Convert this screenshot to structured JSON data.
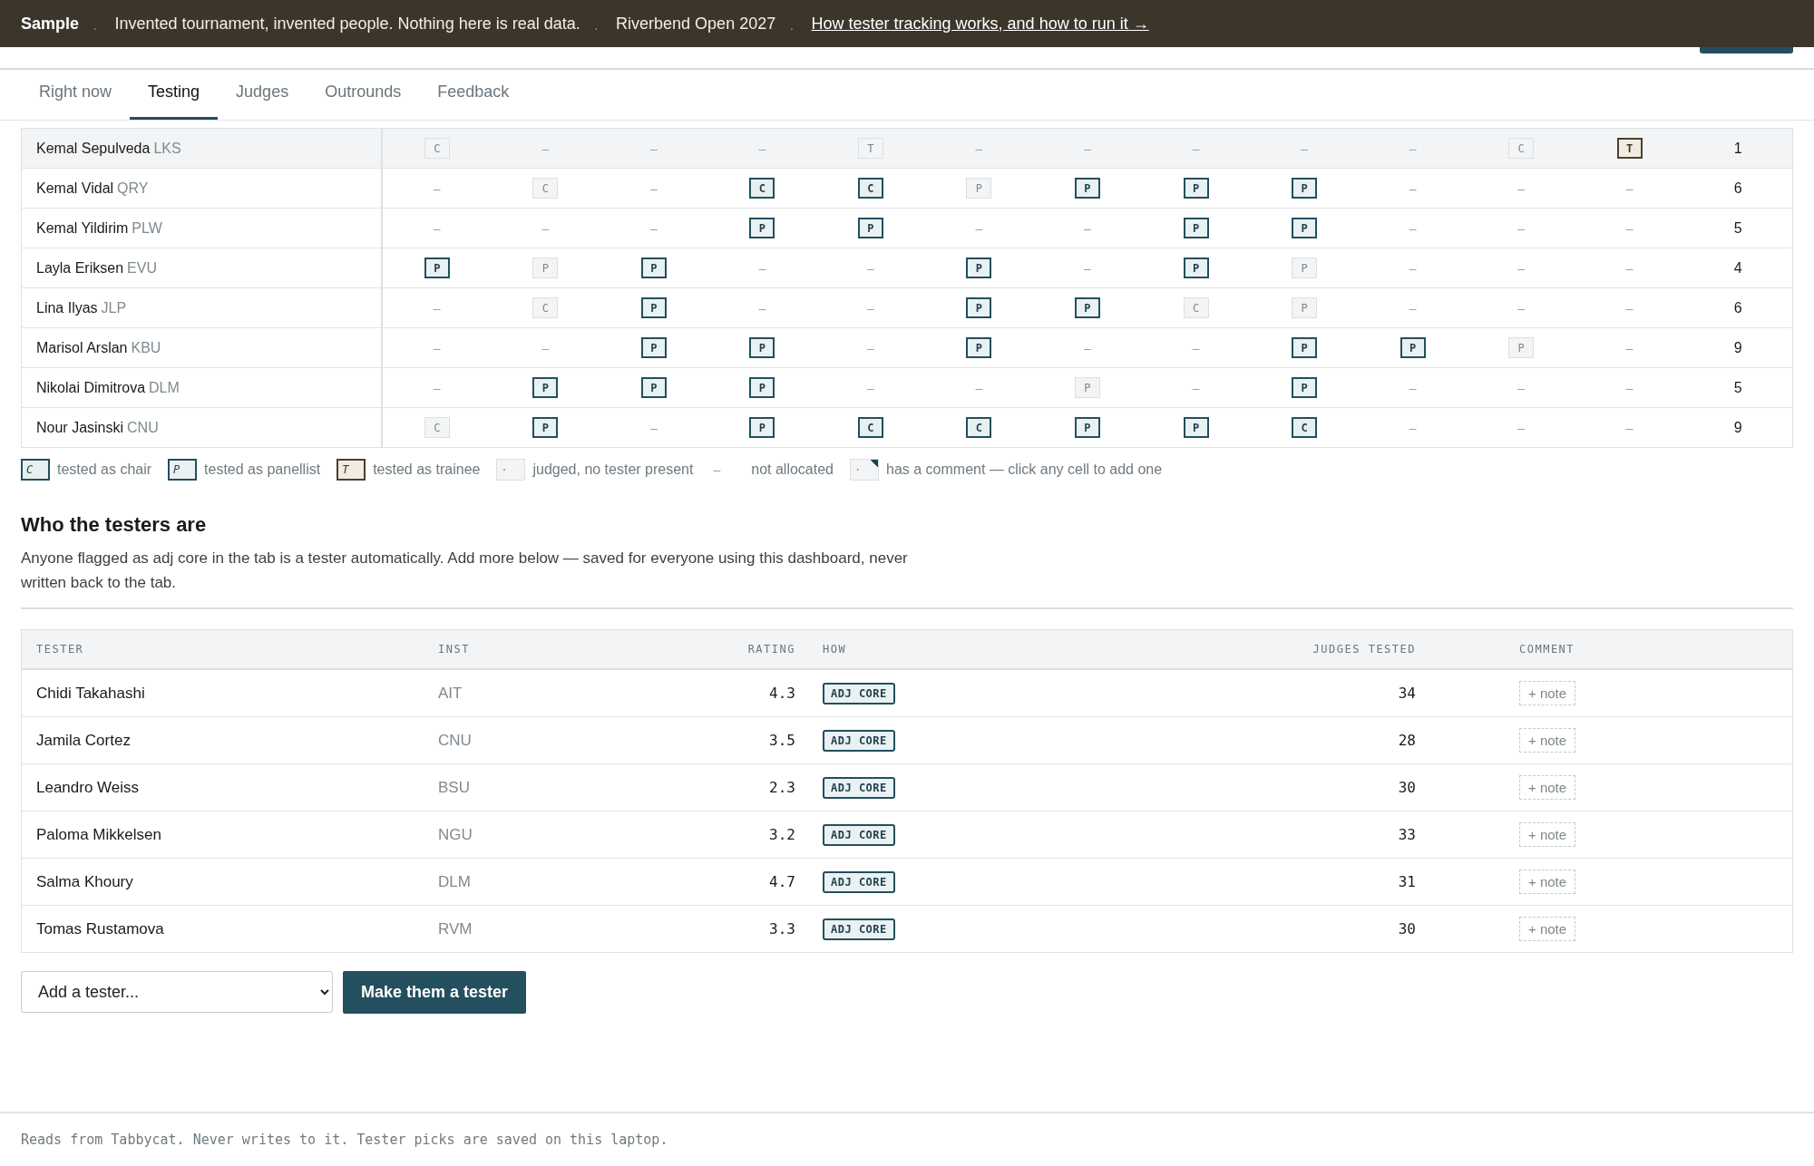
{
  "top_bar": {
    "items": [
      {
        "kind": "brand",
        "text": "Sample"
      },
      {
        "kind": "sep",
        "text": "."
      },
      {
        "kind": "text",
        "text": "Invented tournament, invented people. Nothing here is real data."
      },
      {
        "kind": "sep",
        "text": "."
      },
      {
        "kind": "text",
        "text": "Riverbend Open 2027"
      },
      {
        "kind": "sep",
        "text": "."
      },
      {
        "kind": "link",
        "text": "How tester tracking works, and how to run it →"
      }
    ]
  },
  "tabs": [
    {
      "label": "Right now",
      "selected": false
    },
    {
      "label": "Testing",
      "selected": true
    },
    {
      "label": "Judges",
      "selected": false
    },
    {
      "label": "Outrounds",
      "selected": false
    },
    {
      "label": "Feedback",
      "selected": false
    }
  ],
  "grid": {
    "rows": [
      {
        "name": "Kemal Sepulveda",
        "inst": "LKS",
        "highlighted": true,
        "count": "1",
        "cells": [
          {
            "kind": "untested",
            "text": "C"
          },
          {
            "kind": "empty",
            "text": "–"
          },
          {
            "kind": "empty",
            "text": "–"
          },
          {
            "kind": "empty",
            "text": "–"
          },
          {
            "kind": "untested",
            "text": "T"
          },
          {
            "kind": "empty",
            "text": "–"
          },
          {
            "kind": "empty",
            "text": "–"
          },
          {
            "kind": "empty",
            "text": "–"
          },
          {
            "kind": "empty",
            "text": "–"
          },
          {
            "kind": "empty",
            "text": "–"
          },
          {
            "kind": "untested",
            "text": "C"
          },
          {
            "kind": "trainee",
            "text": "T"
          }
        ]
      },
      {
        "name": "Kemal Vidal",
        "inst": "QRY",
        "highlighted": false,
        "count": "6",
        "cells": [
          {
            "kind": "empty",
            "text": "–"
          },
          {
            "kind": "untested",
            "text": "C"
          },
          {
            "kind": "empty",
            "text": "–"
          },
          {
            "kind": "chair",
            "text": "C"
          },
          {
            "kind": "chair",
            "text": "C"
          },
          {
            "kind": "untested",
            "text": "P"
          },
          {
            "kind": "panellist",
            "text": "P"
          },
          {
            "kind": "panellist",
            "text": "P"
          },
          {
            "kind": "panellist",
            "text": "P"
          },
          {
            "kind": "empty",
            "text": "–"
          },
          {
            "kind": "empty",
            "text": "–"
          },
          {
            "kind": "empty",
            "text": "–"
          }
        ]
      },
      {
        "name": "Kemal Yildirim",
        "inst": "PLW",
        "highlighted": false,
        "count": "5",
        "cells": [
          {
            "kind": "empty",
            "text": "–"
          },
          {
            "kind": "empty",
            "text": "–"
          },
          {
            "kind": "empty",
            "text": "–"
          },
          {
            "kind": "panellist",
            "text": "P"
          },
          {
            "kind": "panellist",
            "text": "P"
          },
          {
            "kind": "empty",
            "text": "–"
          },
          {
            "kind": "empty",
            "text": "–"
          },
          {
            "kind": "panellist",
            "text": "P"
          },
          {
            "kind": "panellist",
            "text": "P"
          },
          {
            "kind": "empty",
            "text": "–"
          },
          {
            "kind": "empty",
            "text": "–"
          },
          {
            "kind": "empty",
            "text": "–"
          }
        ]
      },
      {
        "name": "Layla Eriksen",
        "inst": "EVU",
        "highlighted": false,
        "count": "4",
        "cells": [
          {
            "kind": "panellist",
            "text": "P"
          },
          {
            "kind": "untested",
            "text": "P"
          },
          {
            "kind": "panellist",
            "text": "P"
          },
          {
            "kind": "empty",
            "text": "–"
          },
          {
            "kind": "empty",
            "text": "–"
          },
          {
            "kind": "panellist",
            "text": "P"
          },
          {
            "kind": "empty",
            "text": "–"
          },
          {
            "kind": "panellist",
            "text": "P"
          },
          {
            "kind": "untested",
            "text": "P"
          },
          {
            "kind": "empty",
            "text": "–"
          },
          {
            "kind": "empty",
            "text": "–"
          },
          {
            "kind": "empty",
            "text": "–"
          }
        ]
      },
      {
        "name": "Lina Ilyas",
        "inst": "JLP",
        "highlighted": false,
        "count": "6",
        "cells": [
          {
            "kind": "empty",
            "text": "–"
          },
          {
            "kind": "untested",
            "text": "C"
          },
          {
            "kind": "panellist",
            "text": "P"
          },
          {
            "kind": "empty",
            "text": "–"
          },
          {
            "kind": "empty",
            "text": "–"
          },
          {
            "kind": "panellist",
            "text": "P"
          },
          {
            "kind": "panellist",
            "text": "P"
          },
          {
            "kind": "untested",
            "text": "C"
          },
          {
            "kind": "untested",
            "text": "P"
          },
          {
            "kind": "empty",
            "text": "–"
          },
          {
            "kind": "empty",
            "text": "–"
          },
          {
            "kind": "empty",
            "text": "–"
          }
        ]
      },
      {
        "name": "Marisol Arslan",
        "inst": "KBU",
        "highlighted": false,
        "count": "9",
        "cells": [
          {
            "kind": "empty",
            "text": "–"
          },
          {
            "kind": "empty",
            "text": "–"
          },
          {
            "kind": "panellist",
            "text": "P"
          },
          {
            "kind": "panellist",
            "text": "P"
          },
          {
            "kind": "empty",
            "text": "–"
          },
          {
            "kind": "panellist",
            "text": "P"
          },
          {
            "kind": "empty",
            "text": "–"
          },
          {
            "kind": "empty",
            "text": "–"
          },
          {
            "kind": "panellist",
            "text": "P"
          },
          {
            "kind": "panellist",
            "text": "P"
          },
          {
            "kind": "untested",
            "text": "P"
          },
          {
            "kind": "empty",
            "text": "–"
          }
        ]
      },
      {
        "name": "Nikolai Dimitrova",
        "inst": "DLM",
        "highlighted": false,
        "count": "5",
        "cells": [
          {
            "kind": "empty",
            "text": "–"
          },
          {
            "kind": "panellist",
            "text": "P"
          },
          {
            "kind": "panellist",
            "text": "P"
          },
          {
            "kind": "panellist",
            "text": "P"
          },
          {
            "kind": "empty",
            "text": "–"
          },
          {
            "kind": "empty",
            "text": "–"
          },
          {
            "kind": "untested",
            "text": "P"
          },
          {
            "kind": "empty",
            "text": "–"
          },
          {
            "kind": "panellist",
            "text": "P"
          },
          {
            "kind": "empty",
            "text": "–"
          },
          {
            "kind": "empty",
            "text": "–"
          },
          {
            "kind": "empty",
            "text": "–"
          }
        ]
      },
      {
        "name": "Nour Jasinski",
        "inst": "CNU",
        "highlighted": false,
        "count": "9",
        "cells": [
          {
            "kind": "untested",
            "text": "C"
          },
          {
            "kind": "panellist",
            "text": "P"
          },
          {
            "kind": "empty",
            "text": "–"
          },
          {
            "kind": "panellist",
            "text": "P"
          },
          {
            "kind": "chair",
            "text": "C"
          },
          {
            "kind": "chair",
            "text": "C"
          },
          {
            "kind": "panellist",
            "text": "P"
          },
          {
            "kind": "panellist",
            "text": "P"
          },
          {
            "kind": "chair",
            "text": "C"
          },
          {
            "kind": "empty",
            "text": "–"
          },
          {
            "kind": "empty",
            "text": "–"
          },
          {
            "kind": "empty",
            "text": "–"
          }
        ]
      }
    ]
  },
  "legend": [
    {
      "kind": "chair",
      "swatch": "C",
      "label": "tested as chair"
    },
    {
      "kind": "panellist",
      "swatch": "P",
      "label": "tested as panellist"
    },
    {
      "kind": "trainee",
      "swatch": "T",
      "label": "tested as trainee"
    },
    {
      "kind": "untested",
      "swatch": "·",
      "label": "judged, no tester present"
    },
    {
      "kind": "empty",
      "swatch": "–",
      "label": "not allocated"
    },
    {
      "kind": "comment",
      "swatch": "·",
      "label": "has a comment — click any cell to add one"
    }
  ],
  "testers": {
    "title": "Who the testers are",
    "description": "Anyone flagged as adj core in the tab is a tester automatically. Add more below — saved for everyone using this dashboard, never written back to the tab.",
    "columns": [
      "TESTER",
      "INST",
      "RATING",
      "HOW",
      "JUDGES TESTED",
      "COMMENT"
    ],
    "rows": [
      {
        "name": "Chidi Takahashi",
        "inst": "AIT",
        "rating": "4.3",
        "how": "ADJ CORE",
        "judges_tested": "34",
        "comment": "+ note"
      },
      {
        "name": "Jamila Cortez",
        "inst": "CNU",
        "rating": "3.5",
        "how": "ADJ CORE",
        "judges_tested": "28",
        "comment": "+ note"
      },
      {
        "name": "Leandro Weiss",
        "inst": "BSU",
        "rating": "2.3",
        "how": "ADJ CORE",
        "judges_tested": "30",
        "comment": "+ note"
      },
      {
        "name": "Paloma Mikkelsen",
        "inst": "NGU",
        "rating": "3.2",
        "how": "ADJ CORE",
        "judges_tested": "33",
        "comment": "+ note"
      },
      {
        "name": "Salma Khoury",
        "inst": "DLM",
        "rating": "4.7",
        "how": "ADJ CORE",
        "judges_tested": "31",
        "comment": "+ note"
      },
      {
        "name": "Tomas Rustamova",
        "inst": "RVM",
        "rating": "3.3",
        "how": "ADJ CORE",
        "judges_tested": "30",
        "comment": "+ note"
      }
    ],
    "add_select": {
      "value": "Add a tester..."
    },
    "add_button": "Make them a tester"
  },
  "footer": "Reads from Tabbycat. Never writes to it. Tester picks are saved on this laptop."
}
